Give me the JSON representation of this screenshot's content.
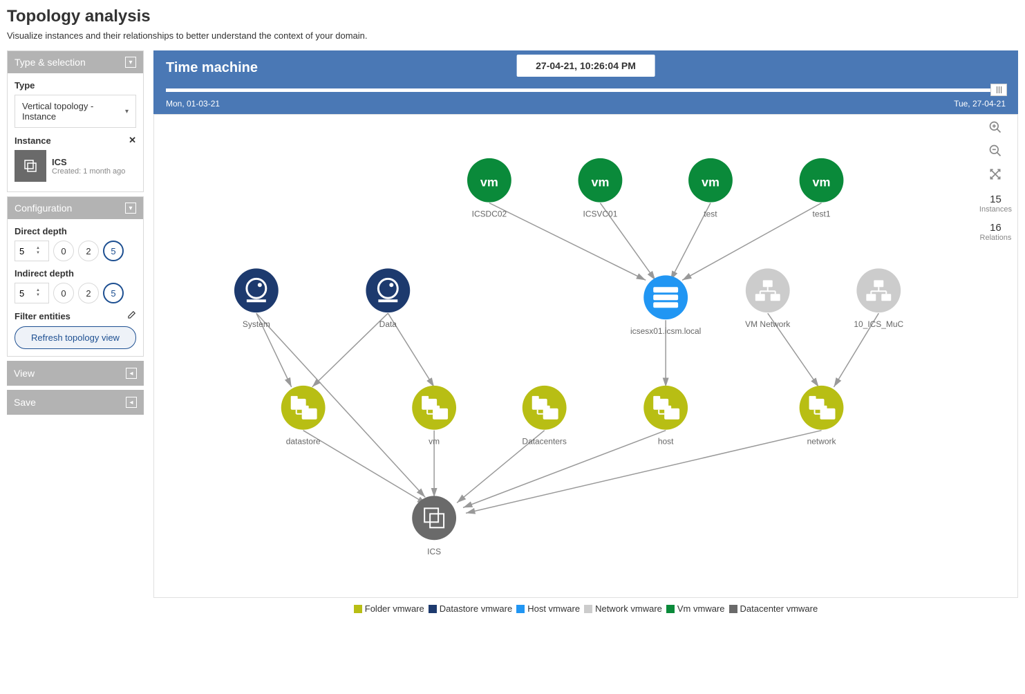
{
  "page_title": "Topology analysis",
  "subtitle": "Visualize instances and their relationships to better understand the context of your domain.",
  "sidebar": {
    "type_selection_header": "Type & selection",
    "type_label": "Type",
    "type_value": "Vertical topology - Instance",
    "instance_label": "Instance",
    "instance_name": "ICS",
    "instance_meta": "Created: 1 month ago",
    "configuration_header": "Configuration",
    "direct_depth_label": "Direct depth",
    "direct_depth_value": "5",
    "direct_depth_options": [
      "0",
      "2",
      "5"
    ],
    "indirect_depth_label": "Indirect depth",
    "indirect_depth_value": "5",
    "indirect_depth_options": [
      "0",
      "2",
      "5"
    ],
    "filter_entities_label": "Filter entities",
    "refresh_label": "Refresh topology view",
    "view_header": "View",
    "save_header": "Save"
  },
  "time_machine": {
    "title": "Time machine",
    "current": "27-04-21, 10:26:04 PM",
    "start_label": "Mon, 01-03-21",
    "end_label": "Tue, 27-04-21"
  },
  "stats": {
    "instances_count": "15",
    "instances_label": "Instances",
    "relations_count": "16",
    "relations_label": "Relations"
  },
  "nodes": {
    "icsdc02": "ICSDC02",
    "icsvc01": "ICSVC01",
    "test": "test",
    "test1": "test1",
    "system": "System",
    "data": "Data",
    "icsesx01": "icsesx01.icsm.local",
    "vmnetwork": "VM Network",
    "icsmuc": "10_ICS_MuC",
    "datastore": "datastore",
    "vm": "vm",
    "datacenters": "Datacenters",
    "host": "host",
    "network": "network",
    "ics": "ICS"
  },
  "legend": {
    "items": [
      {
        "label": "Folder vmware",
        "color": "#b8be14"
      },
      {
        "label": "Datastore vmware",
        "color": "#1d3a6e"
      },
      {
        "label": "Host vmware",
        "color": "#2196f3"
      },
      {
        "label": "Network vmware",
        "color": "#cccccc"
      },
      {
        "label": "Vm vmware",
        "color": "#0a8a3a"
      },
      {
        "label": "Datacenter vmware",
        "color": "#6a6a6a"
      }
    ]
  },
  "colors": {
    "folder": "#b8be14",
    "datastore": "#1d3a6e",
    "host": "#2196f3",
    "network_node": "#cccccc",
    "vm": "#0a8a3a",
    "datacenter": "#6a6a6a"
  }
}
